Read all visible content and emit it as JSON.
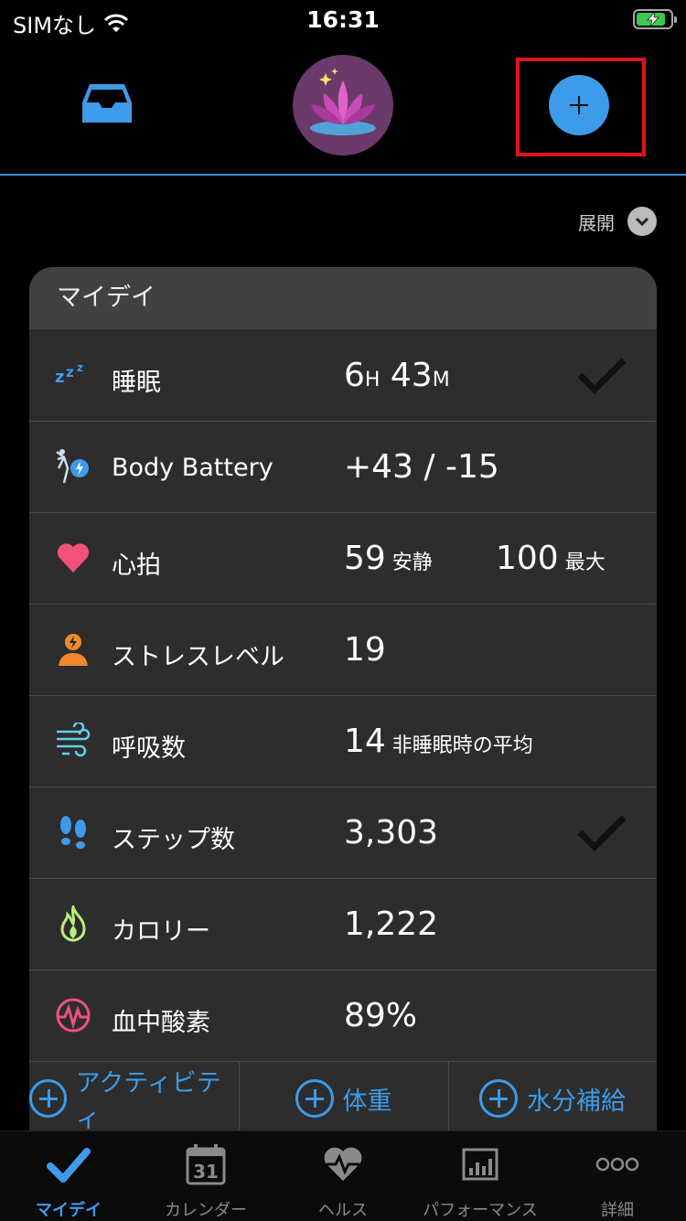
{
  "status_bar": {
    "carrier": "SIMなし",
    "time": "16:31",
    "battery_level": 0.85
  },
  "header": {
    "add_label": "+"
  },
  "expand": {
    "label": "展開"
  },
  "card": {
    "title": "マイデイ",
    "rows": [
      {
        "icon": "sleep-zzz-icon",
        "label": "睡眠",
        "value_main": "6",
        "unit1": "H",
        "value_b": " 43",
        "unit2": "M",
        "checked": true
      },
      {
        "icon": "body-battery-icon",
        "label": "Body Battery",
        "value_main": "+43 / -15"
      },
      {
        "icon": "heart-icon",
        "label": "心拍",
        "value_main": "59",
        "unit1": " 安静",
        "value2": "100",
        "unit2": " 最大"
      },
      {
        "icon": "stress-person-icon",
        "label": "ストレスレベル",
        "value_main": "19"
      },
      {
        "icon": "respiration-wind-icon",
        "label": "呼吸数",
        "value_main": "14",
        "unit1": " 非睡眠時の平均"
      },
      {
        "icon": "footsteps-icon",
        "label": "ステップ数",
        "value_main": "3,303",
        "checked": true
      },
      {
        "icon": "flame-icon",
        "label": "カロリー",
        "value_main": "1,222"
      },
      {
        "icon": "blood-oxygen-icon",
        "label": "血中酸素",
        "value_main": "89%"
      }
    ]
  },
  "quick_actions": [
    {
      "label": "アクティビティ"
    },
    {
      "label": "体重"
    },
    {
      "label": "水分補給"
    }
  ],
  "tabs": [
    {
      "label": "マイデイ",
      "icon": "checkmark-icon",
      "active": true
    },
    {
      "label": "カレンダー",
      "icon": "calendar-icon",
      "day": "31"
    },
    {
      "label": "ヘルス",
      "icon": "heart-pulse-icon"
    },
    {
      "label": "パフォーマンス",
      "icon": "chart-icon"
    },
    {
      "label": "詳細",
      "icon": "more-dots-icon"
    }
  ],
  "colors": {
    "accent": "#3d9be9",
    "highlight": "#e0141e",
    "card": "#2d2d2d"
  }
}
